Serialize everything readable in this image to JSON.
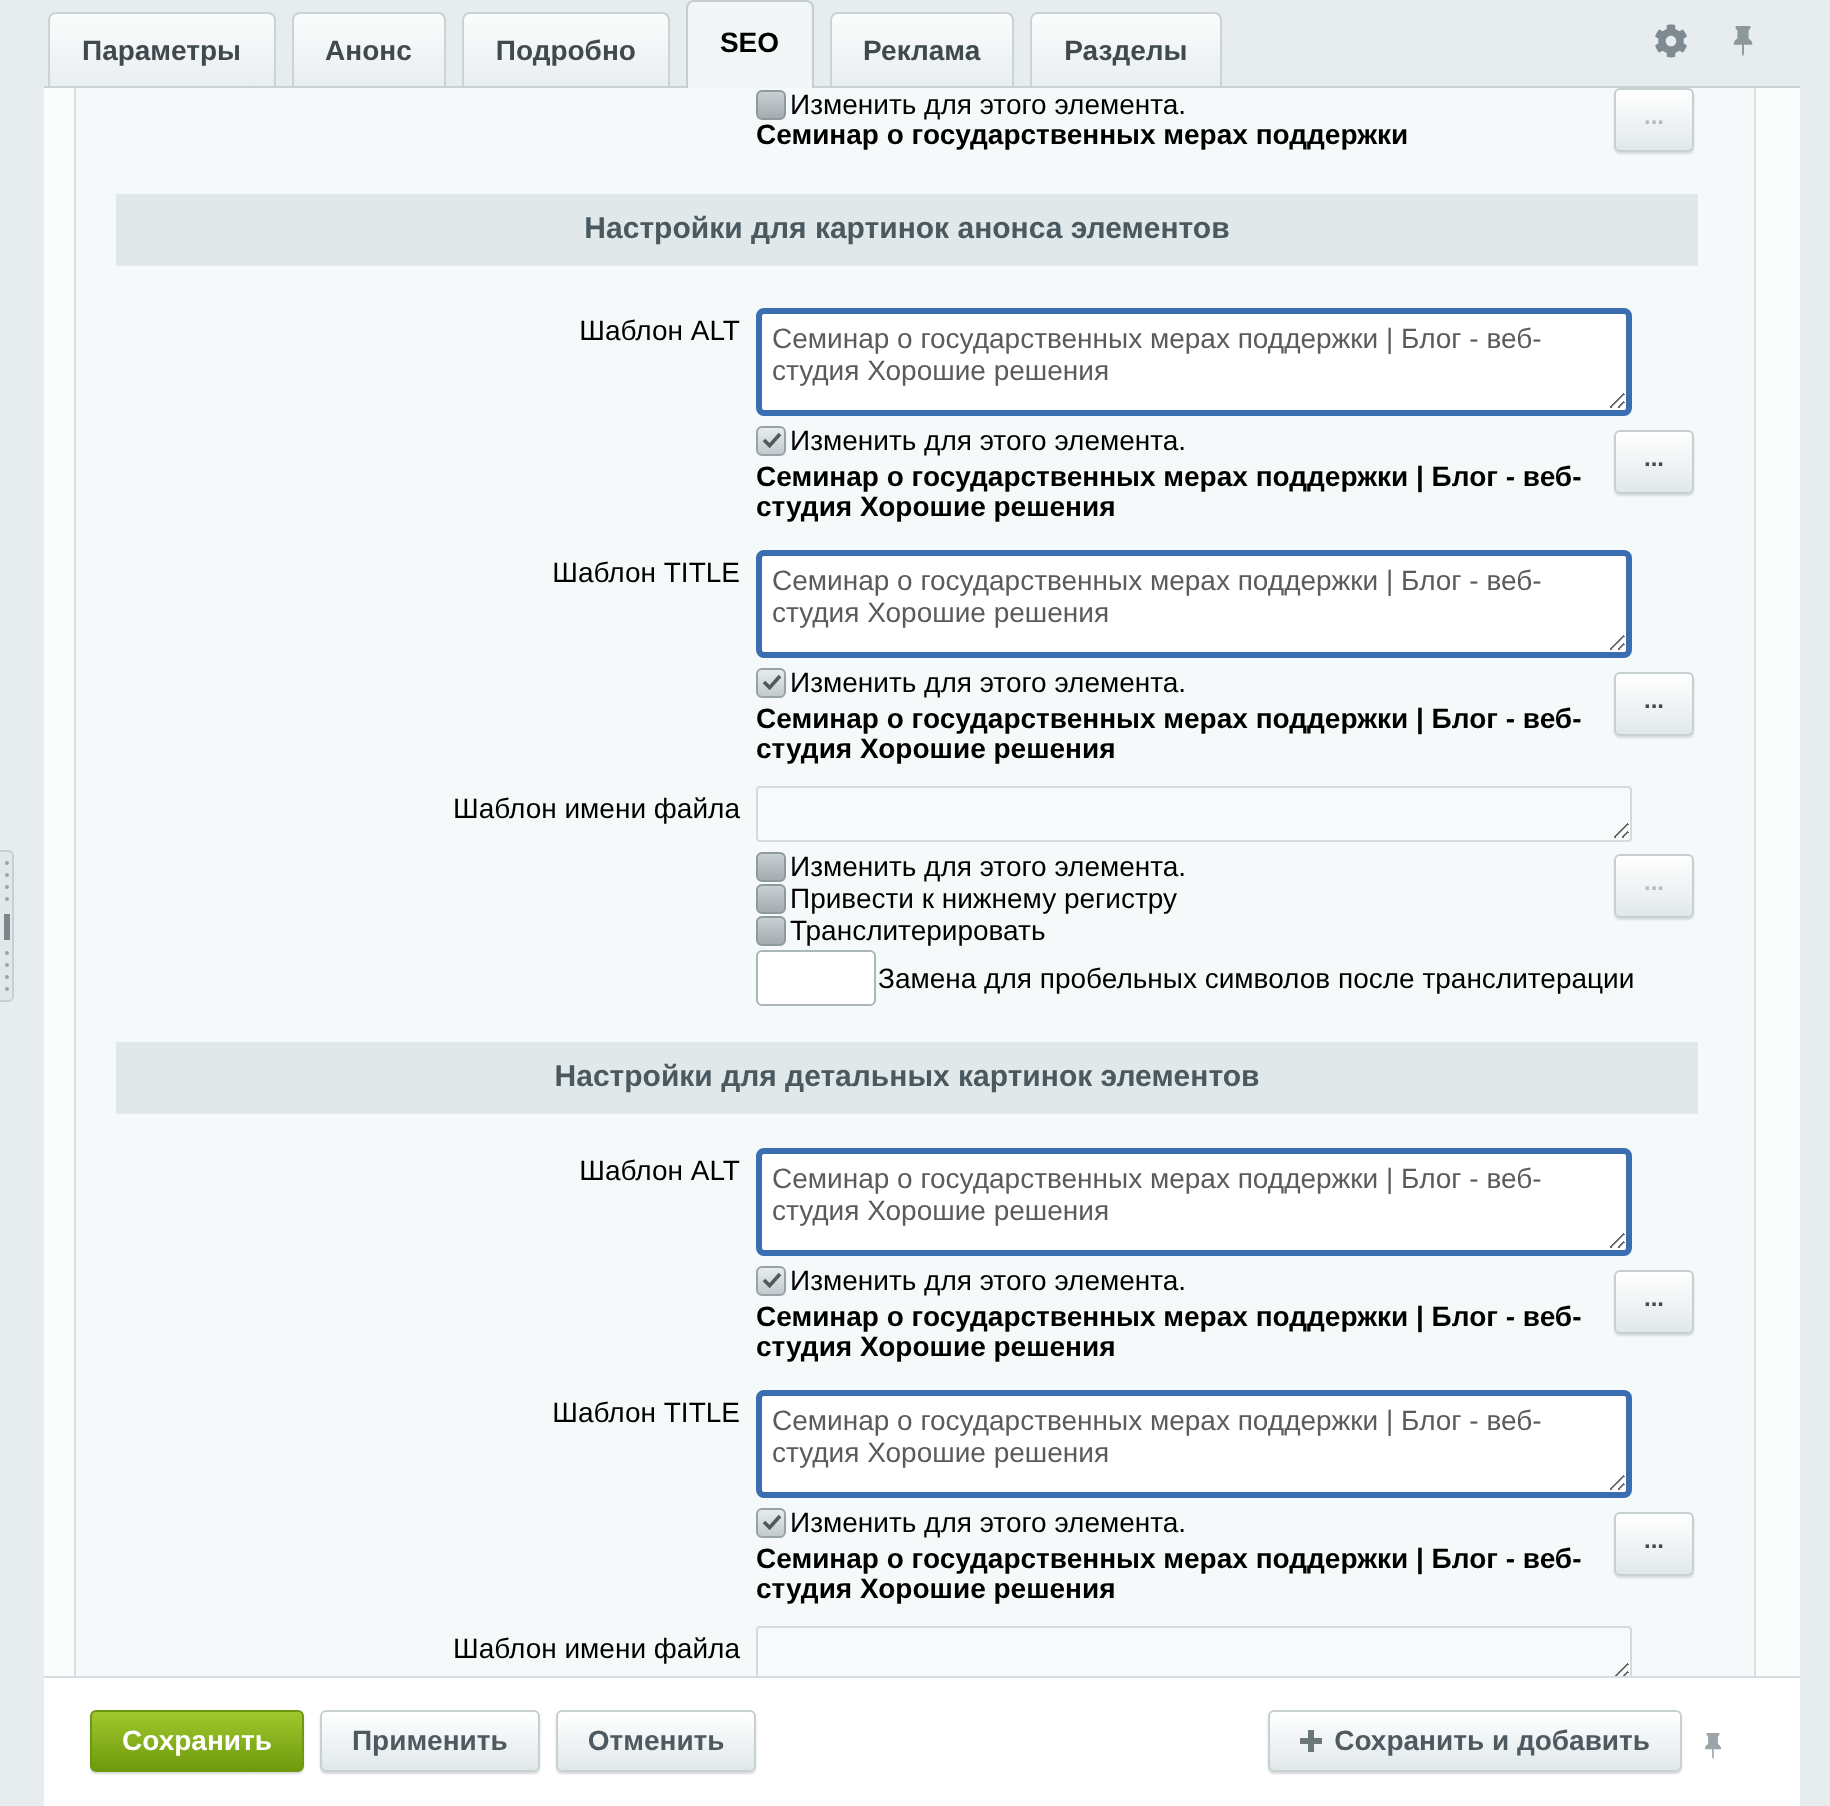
{
  "tabs": [
    {
      "label": "Параметры",
      "selected": false
    },
    {
      "label": "Анонс",
      "selected": false
    },
    {
      "label": "Подробно",
      "selected": false
    },
    {
      "label": "SEO",
      "selected": true
    },
    {
      "label": "Реклама",
      "selected": false
    },
    {
      "label": "Разделы",
      "selected": false
    }
  ],
  "top_item": {
    "override": {
      "label": "Изменить для этого элемента.",
      "checked": false
    },
    "preview": "Семинар о государственных мерах поддержки",
    "button": {
      "label": "...",
      "disabled": true
    }
  },
  "sections": [
    {
      "title": "Настройки для картинок анонса элементов",
      "fields": [
        {
          "kind": "template",
          "label": "Шаблон ALT",
          "value": "Семинар о государственных мерах поддержки | Блог - веб-студия Хорошие решения",
          "override": {
            "label": "Изменить для этого элемента.",
            "checked": true
          },
          "preview": "Семинар о государственных мерах поддержки | Блог - веб-студия Хорошие решения",
          "button": {
            "label": "...",
            "disabled": false
          }
        },
        {
          "kind": "template",
          "label": "Шаблон TITLE",
          "value": "Семинар о государственных мерах поддержки | Блог - веб-студия Хорошие решения",
          "override": {
            "label": "Изменить для этого элемента.",
            "checked": true
          },
          "preview": "Семинар о государственных мерах поддержки | Блог - веб-студия Хорошие решения",
          "button": {
            "label": "...",
            "disabled": false
          }
        },
        {
          "kind": "filename",
          "label": "Шаблон имени файла",
          "override": {
            "label": "Изменить для этого элемента.",
            "checked": false
          },
          "options": [
            {
              "label": "Привести к нижнему регистру",
              "checked": false
            },
            {
              "label": "Транслитерировать",
              "checked": false
            }
          ],
          "replacement": {
            "label": "Замена для пробельных символов после транслитерации"
          },
          "button": {
            "label": "...",
            "disabled": true
          }
        }
      ]
    },
    {
      "title": "Настройки для детальных картинок элементов",
      "fields": [
        {
          "kind": "template",
          "label": "Шаблон ALT",
          "value": "Семинар о государственных мерах поддержки | Блог - веб-студия Хорошие решения",
          "override": {
            "label": "Изменить для этого элемента.",
            "checked": true
          },
          "preview": "Семинар о государственных мерах поддержки | Блог - веб-студия Хорошие решения",
          "button": {
            "label": "...",
            "disabled": false
          }
        },
        {
          "kind": "template",
          "label": "Шаблон TITLE",
          "value": "Семинар о государственных мерах поддержки | Блог - веб-студия Хорошие решения",
          "override": {
            "label": "Изменить для этого элемента.",
            "checked": true
          },
          "preview": "Семинар о государственных мерах поддержки | Блог - веб-студия Хорошие решения",
          "button": {
            "label": "...",
            "disabled": false
          }
        },
        {
          "kind": "filename",
          "label": "Шаблон имени файла"
        }
      ]
    }
  ],
  "footer": {
    "buttons": [
      {
        "kind": "primary",
        "label": "Сохранить"
      },
      {
        "kind": "secondary",
        "label": "Применить"
      },
      {
        "kind": "secondary",
        "label": "Отменить"
      },
      {
        "kind": "add",
        "label": "Сохранить и добавить"
      }
    ]
  }
}
